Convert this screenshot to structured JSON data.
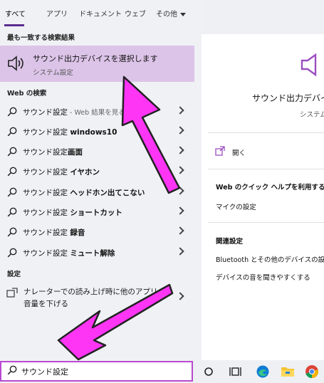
{
  "tabs": [
    {
      "label": "すべて"
    },
    {
      "label": "アプリ"
    },
    {
      "label": "ドキュメント"
    },
    {
      "label": "ウェブ"
    },
    {
      "label": "その他"
    }
  ],
  "best_match": {
    "header": "最も一致する検索結果",
    "title": "サウンド出力デバイスを選択します",
    "subtitle": "システム設定"
  },
  "web": {
    "header": "Web の検索",
    "items": [
      {
        "prefix": "サウンド設定",
        "suffix": " - Web 結果を見る",
        "bold": false
      },
      {
        "prefix": "サウンド設定 ",
        "suffix": "windows10",
        "bold": true
      },
      {
        "prefix": "サウンド設定",
        "suffix": "画面",
        "bold": true
      },
      {
        "prefix": "サウンド設定 ",
        "suffix": "イヤホン",
        "bold": true
      },
      {
        "prefix": "サウンド設定 ",
        "suffix": "ヘッドホン出てこない",
        "bold": true
      },
      {
        "prefix": "サウンド設定 ",
        "suffix": "ショートカット",
        "bold": true
      },
      {
        "prefix": "サウンド設定 ",
        "suffix": "録音",
        "bold": true
      },
      {
        "prefix": "サウンド設定 ",
        "suffix": "ミュート解除",
        "bold": true
      }
    ]
  },
  "settings": {
    "header": "設定",
    "item_line1": "ナレーターでの読み上げ時に他のアプリの",
    "item_line2": "音量を下げる"
  },
  "preview": {
    "title": "サウンド出力デバイ",
    "subtitle": "システム",
    "open": "開く",
    "help_header": "Web のクイック ヘルプを利用する",
    "help_item": "マイクの設定",
    "related_header": "関連設定",
    "related_items": [
      "Bluetooth とその他のデバイスの設定",
      "デバイスの音を聞きやすくする"
    ]
  },
  "search": {
    "value": "サウンド設定"
  },
  "colors": {
    "highlight": "#dcc4e8",
    "accent": "#9b4fc0",
    "arrow": "#ff35f5"
  }
}
